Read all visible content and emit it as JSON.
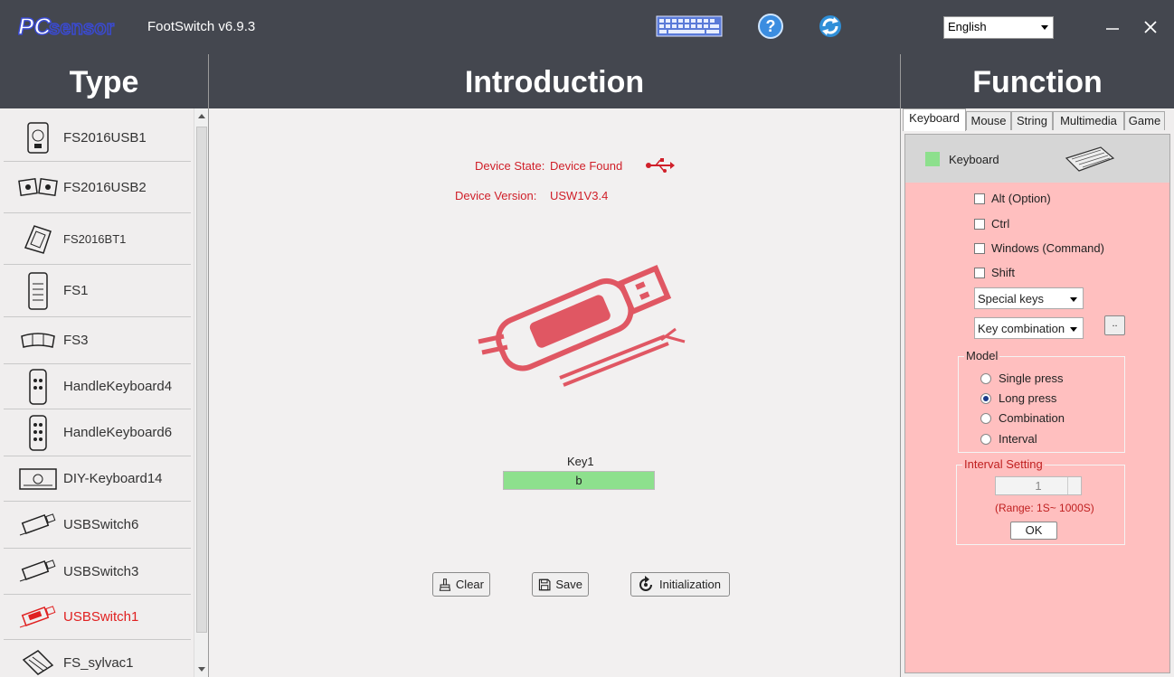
{
  "titlebar": {
    "logo_text": "PCsensor",
    "app_title": "FootSwitch v6.9.3",
    "language": "English",
    "icons": [
      "keyboard-icon",
      "help-icon",
      "refresh-icon"
    ],
    "minimize": "–",
    "close": "✕"
  },
  "headers": {
    "type": "Type",
    "introduction": "Introduction",
    "function": "Function"
  },
  "types": [
    {
      "label": "FS2016USB1",
      "icon": "fs2016usb1-icon"
    },
    {
      "label": "FS2016USB2",
      "icon": "fs2016usb2-icon"
    },
    {
      "label": "FS2016BT1",
      "icon": "fs2016bt1-icon"
    },
    {
      "label": "FS1",
      "icon": "fs1-icon"
    },
    {
      "label": "FS3",
      "icon": "fs3-icon"
    },
    {
      "label": "HandleKeyboard4",
      "icon": "handlekeyboard4-icon"
    },
    {
      "label": "HandleKeyboard6",
      "icon": "handlekeyboard6-icon"
    },
    {
      "label": "DIY-Keyboard14",
      "icon": "diy-keyboard14-icon"
    },
    {
      "label": "USBSwitch6",
      "icon": "usbswitch6-icon"
    },
    {
      "label": "USBSwitch3",
      "icon": "usbswitch3-icon"
    },
    {
      "label": "USBSwitch1",
      "icon": "usbswitch1-icon",
      "active": true
    },
    {
      "label": "FS_sylvac1",
      "icon": "fs-sylvac1-icon"
    }
  ],
  "intro": {
    "device_state_label": "Device State:",
    "device_state_value": "Device Found",
    "device_version_label": "Device Version:",
    "device_version_value": "USW1V3.4",
    "key_label": "Key1",
    "key_value": "b",
    "clear": "Clear",
    "save": "Save",
    "initialization": "Initialization"
  },
  "function": {
    "tabs": [
      "Keyboard",
      "Mouse",
      "String",
      "Multimedia",
      "Game"
    ],
    "active_tab": "Keyboard",
    "mode_label": "Keyboard",
    "modifiers": [
      "Alt (Option)",
      "Ctrl",
      "Windows (Command)",
      "Shift"
    ],
    "special_keys": "Special keys",
    "key_combination": "Key combination",
    "more_button": "..",
    "model_title": "Model",
    "models": [
      "Single press",
      "Long press",
      "Combination",
      "Interval"
    ],
    "selected_model": "Long press",
    "interval_title": "Interval Setting",
    "interval_value": "1",
    "range_text": "(Range: 1S~ 1000S)",
    "ok": "OK"
  },
  "colors": {
    "header_bg": "#44474f",
    "accent_red": "#d0202a",
    "pink_panel": "#ffbfbf",
    "key_green": "#8de08d",
    "device_pink": "#e05763"
  }
}
